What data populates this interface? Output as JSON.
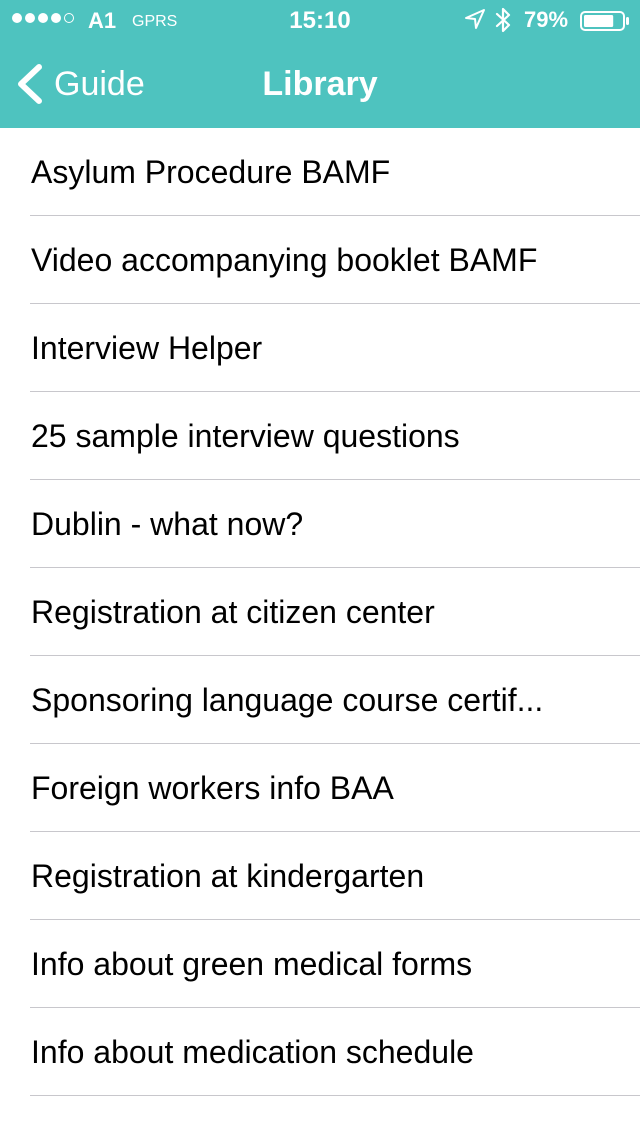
{
  "colors": {
    "accent": "#4ec3bf",
    "text": "#000000",
    "separator": "#c8c7cc"
  },
  "status_bar": {
    "signal_strength": "4 of 5",
    "carrier": "A1",
    "network": "GPRS",
    "time": "15:10",
    "location_icon": "location-arrow-icon",
    "bluetooth_icon": "bluetooth-icon",
    "battery_percent": "79%",
    "battery_level": 0.79
  },
  "nav": {
    "back_label": "Guide",
    "title": "Library"
  },
  "library": {
    "items": [
      {
        "label": "Asylum Procedure BAMF"
      },
      {
        "label": "Video accompanying booklet BAMF"
      },
      {
        "label": "Interview Helper"
      },
      {
        "label": "25 sample interview questions"
      },
      {
        "label": "Dublin - what now?"
      },
      {
        "label": "Registration at citizen center"
      },
      {
        "label": "Sponsoring language course certif..."
      },
      {
        "label": "Foreign workers info BAA"
      },
      {
        "label": "Registration at kindergarten"
      },
      {
        "label": "Info about green medical forms"
      },
      {
        "label": "Info about medication schedule"
      }
    ]
  }
}
